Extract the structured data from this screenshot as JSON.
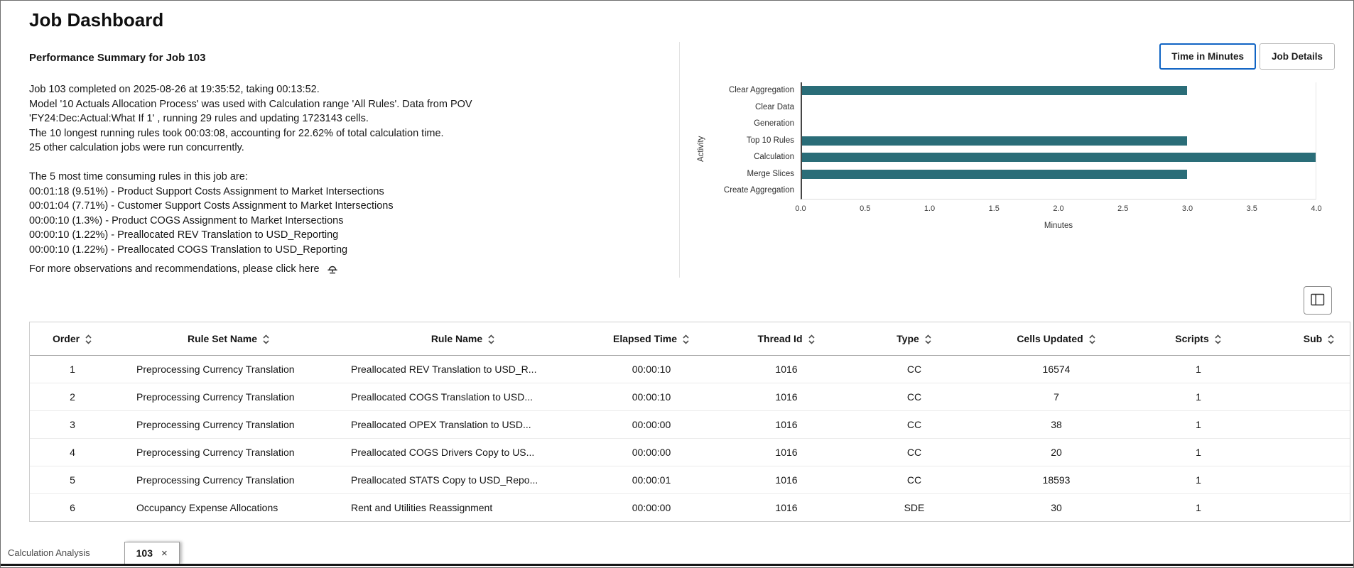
{
  "page": {
    "title": "Job Dashboard"
  },
  "summary": {
    "heading": "Performance Summary for Job 103",
    "lines": [
      "Job 103 completed on 2025-08-26 at 19:35:52, taking 00:13:52.",
      "Model '10 Actuals Allocation Process' was used with Calculation range 'All Rules'. Data from POV",
      "'FY24:Dec:Actual:What If 1' , running 29 rules and updating 1723143 cells.",
      "The 10 longest running rules took 00:03:08, accounting for 22.62% of total calculation time.",
      "25 other calculation jobs were run concurrently.",
      "",
      "The 5 most time consuming rules in this job are:",
      "00:01:18 (9.51%) - Product Support Costs Assignment to Market Intersections",
      "00:01:04 (7.71%) - Customer Support Costs Assignment to Market Intersections",
      "00:00:10 (1.3%) - Product COGS Assignment to Market Intersections",
      "00:00:10 (1.22%) - Preallocated REV Translation to USD_Reporting",
      "00:00:10 (1.22%) - Preallocated COGS Translation to USD_Reporting"
    ],
    "link_text": "For more observations and recommendations, please click here"
  },
  "toggle": {
    "options": [
      {
        "label": "Time in Minutes",
        "selected": true
      },
      {
        "label": "Job Details",
        "selected": false
      }
    ]
  },
  "chart_data": {
    "type": "bar",
    "orientation": "horizontal",
    "title": "",
    "categories": [
      "Clear Aggregation",
      "Clear Data",
      "Generation",
      "Top 10 Rules",
      "Calculation",
      "Merge Slices",
      "Create Aggregation"
    ],
    "values": [
      3.0,
      0,
      0,
      3.0,
      4.0,
      3.0,
      0
    ],
    "xlabel": "Minutes",
    "ylabel": "Activity",
    "xlim": [
      0,
      4.0
    ],
    "xticks": [
      0.0,
      0.5,
      1.0,
      1.5,
      2.0,
      2.5,
      3.0,
      3.5,
      4.0
    ],
    "grid": false,
    "legend": false,
    "bar_color": "#2a6d78"
  },
  "table": {
    "columns": [
      "Order",
      "Rule Set Name",
      "Rule Name",
      "Elapsed Time",
      "Thread Id",
      "Type",
      "Cells Updated",
      "Scripts",
      "Sub"
    ],
    "rows": [
      [
        "1",
        "Preprocessing Currency Translation",
        "Preallocated REV Translation to USD_R...",
        "00:00:10",
        "1016",
        "CC",
        "16574",
        "1"
      ],
      [
        "2",
        "Preprocessing Currency Translation",
        "Preallocated COGS Translation to USD...",
        "00:00:10",
        "1016",
        "CC",
        "7",
        "1"
      ],
      [
        "3",
        "Preprocessing Currency Translation",
        "Preallocated OPEX Translation to USD...",
        "00:00:00",
        "1016",
        "CC",
        "38",
        "1"
      ],
      [
        "4",
        "Preprocessing Currency Translation",
        "Preallocated COGS Drivers Copy to US...",
        "00:00:00",
        "1016",
        "CC",
        "20",
        "1"
      ],
      [
        "5",
        "Preprocessing Currency Translation",
        "Preallocated STATS Copy to USD_Repo...",
        "00:00:01",
        "1016",
        "CC",
        "18593",
        "1"
      ],
      [
        "6",
        "Occupancy Expense Allocations",
        "Rent and Utilities Reassignment",
        "00:00:00",
        "1016",
        "SDE",
        "30",
        "1"
      ]
    ]
  },
  "icons": {
    "recommendation": "advisor-beacon",
    "manage_columns": "manage-columns",
    "sort": "sort-arrows",
    "close": "×"
  },
  "footer": {
    "label": "Calculation Analysis",
    "tab": "103"
  }
}
